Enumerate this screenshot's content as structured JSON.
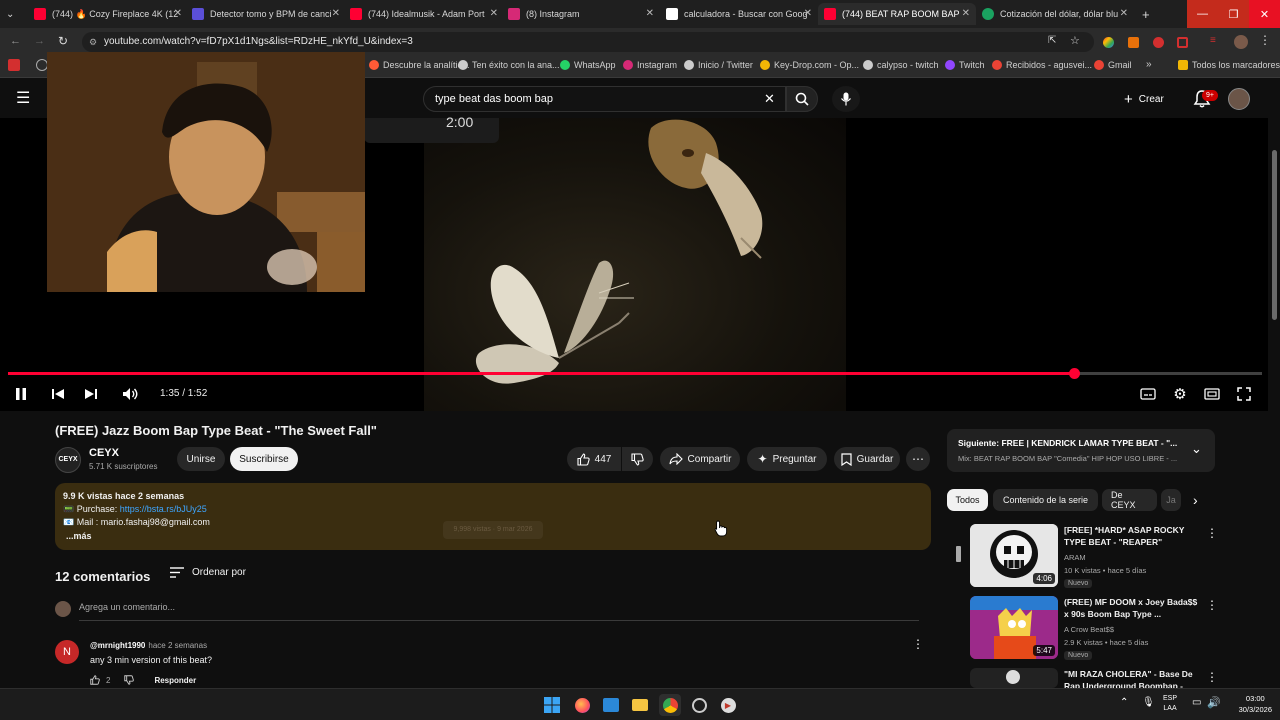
{
  "browser": {
    "tabs": [
      {
        "title": "(744) 🔥 Cozy Fireplace 4K (12",
        "fav": "#ff0033"
      },
      {
        "title": "Detector tomo y BPM de canci",
        "fav": "#5b4fd8"
      },
      {
        "title": "(744) Idealmusik - Adam Port",
        "fav": "#ff0033"
      },
      {
        "title": "(8) Instagram",
        "fav": "#d62976"
      },
      {
        "title": "calculadora - Buscar con Goog",
        "fav": "#ffffff"
      },
      {
        "title": "(744) BEAT RAP BOOM BAP",
        "fav": "#ff0033"
      },
      {
        "title": "Cotización del dólar, dólar blu",
        "fav": "#1aa260"
      }
    ],
    "new_tab": "+",
    "url": "youtube.com/watch?v=fD7pX1d1Ngs&list=RDzHE_nkYfd_U&index=3",
    "bookmarks": [
      {
        "label": "Descubre la analític...",
        "color": "#ff5a36"
      },
      {
        "label": "Ten éxito con la ana...",
        "color": "#cccccc"
      },
      {
        "label": "WhatsApp",
        "color": "#25d366"
      },
      {
        "label": "Instagram",
        "color": "#d62976"
      },
      {
        "label": "Inicio / Twitter",
        "color": "#cccccc"
      },
      {
        "label": "Key-Drop.com - Op...",
        "color": "#f2b705"
      },
      {
        "label": "calypso - twitch",
        "color": "#cccccc"
      },
      {
        "label": "Twitch",
        "color": "#9146ff"
      },
      {
        "label": "Recibidos - agusvei...",
        "color": "#ea4335"
      },
      {
        "label": "Gmail",
        "color": "#ea4335"
      },
      {
        "label": "Todos los marcadores",
        "color": "#f2b705"
      }
    ]
  },
  "youtube": {
    "search_query": "type beat das boom bap",
    "create_label": "Crear",
    "notif_badge": "9+"
  },
  "player": {
    "overlay_time": "2:00",
    "current_time": "1:35 / 1:52",
    "progress": 0.85
  },
  "video": {
    "title": "(FREE) Jazz Boom Bap Type Beat - \"The Sweet Fall\"",
    "channel_logo": "CEYX",
    "channel": "CEYX",
    "subscribers": "5.71 K suscriptores",
    "join_label": "Unirse",
    "subscribe_label": "Suscribirse",
    "likes": "447",
    "share_label": "Compartir",
    "ask_label": "Preguntar",
    "save_label": "Guardar",
    "description": {
      "stats": "9.9 K vistas  hace 2 semanas",
      "purchase_prefix": "📟 Purchase: ",
      "purchase_link": "https://bsta.rs/bJUy25",
      "mail": "📧 Mail : mario.fashaj98@gmail.com",
      "more": "...más",
      "ghost": "9,998 vistas · 9 mar 2026"
    }
  },
  "comments": {
    "count": "12 comentarios",
    "sort_label": "Ordenar por",
    "add_placeholder": "Agrega un comentario...",
    "first": {
      "avatar": "N",
      "author": "@mrnight1990",
      "time": "hace 2 semanas",
      "text": "any 3 min version of this beat?",
      "likes": "2",
      "reply_label": "Responder"
    }
  },
  "sidebar": {
    "next_title": "Siguiente: FREE | KENDRICK LAMAR TYPE BEAT - \"...",
    "next_sub": "Mix: BEAT RAP BOOM BAP \"Comedia\" HIP HOP USO LIBRE - ...",
    "chips": [
      "Todos",
      "Contenido de la serie",
      "De CEYX",
      "Ja"
    ],
    "videos": [
      {
        "title": "[FREE] *HARD* ASAP ROCKY TYPE BEAT - \"REAPER\"",
        "channel": "ARAM",
        "meta": "10 K vistas • hace 5 días",
        "badge": "Nuevo",
        "duration": "4:06"
      },
      {
        "title": "(FREE) MF DOOM x Joey Bada$$ x 90s Boom Bap Type ...",
        "channel": "A Crow Beat$$",
        "meta": "2.9 K vistas • hace 5 días",
        "badge": "Nuevo",
        "duration": "5:47"
      },
      {
        "title": "\"MI RAZA CHOLERA\" - Base De Rap Underground Boombap -",
        "channel": "",
        "meta": "",
        "badge": "",
        "duration": ""
      }
    ]
  },
  "taskbar": {
    "lang_top": "ESP",
    "lang_bottom": "LAA",
    "time": "03:00",
    "date": "30/3/2026"
  }
}
